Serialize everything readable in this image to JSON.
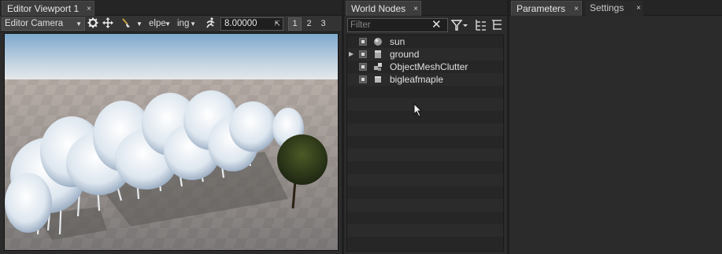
{
  "viewport": {
    "tab_label": "Editor Viewport 1",
    "tab_close": "×",
    "camera_combo": "Editor Camera",
    "helpers_combo": "elpe",
    "render_combo": "ing",
    "speed_value": "8.00000",
    "camera_buttons": [
      "1",
      "2",
      "3"
    ]
  },
  "world_nodes": {
    "tab_label": "World Nodes",
    "tab_close": "×",
    "filter_placeholder": "Filter",
    "nodes": [
      {
        "label": "sun",
        "icon": "sun-icon",
        "expandable": false
      },
      {
        "label": "ground",
        "icon": "object-icon",
        "expandable": true
      },
      {
        "label": "ObjectMeshClutter",
        "icon": "clutter-icon",
        "expandable": false
      },
      {
        "label": "bigleafmaple",
        "icon": "mesh-icon",
        "expandable": false
      }
    ]
  },
  "right_panel": {
    "tabs": [
      {
        "label": "Parameters",
        "close": "×",
        "active": true
      },
      {
        "label": "Settings",
        "close": "×",
        "active": false
      }
    ]
  },
  "colors": {
    "panel_bg": "#2b2b2b",
    "tab_active_bg": "#3d3d3d",
    "sky_top": "#7fa9cf",
    "sky_bottom": "#dfe6ea",
    "ground": "#8a8684"
  }
}
